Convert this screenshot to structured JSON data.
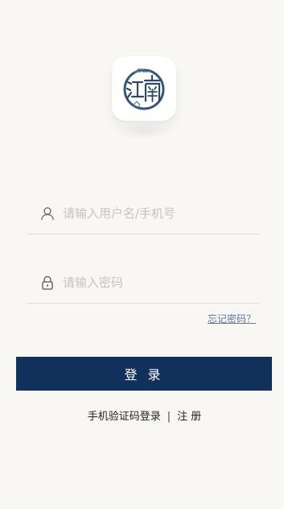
{
  "logo": {
    "icon": "jiangnan-seal-logo"
  },
  "login_form": {
    "username_placeholder": "请输入用户名/手机号",
    "username_value": "",
    "password_placeholder": "请输入密码",
    "password_value": "",
    "forgot_label": "忘记密码？",
    "submit_label": "登 录"
  },
  "footer_links": {
    "sms_login_label": "手机验证码登录",
    "separator": "|",
    "register_label": "注 册"
  },
  "colors": {
    "background": "#f8f7f4",
    "primary": "#11305c",
    "link": "#5b7ba3",
    "placeholder": "#c4c4c4"
  }
}
